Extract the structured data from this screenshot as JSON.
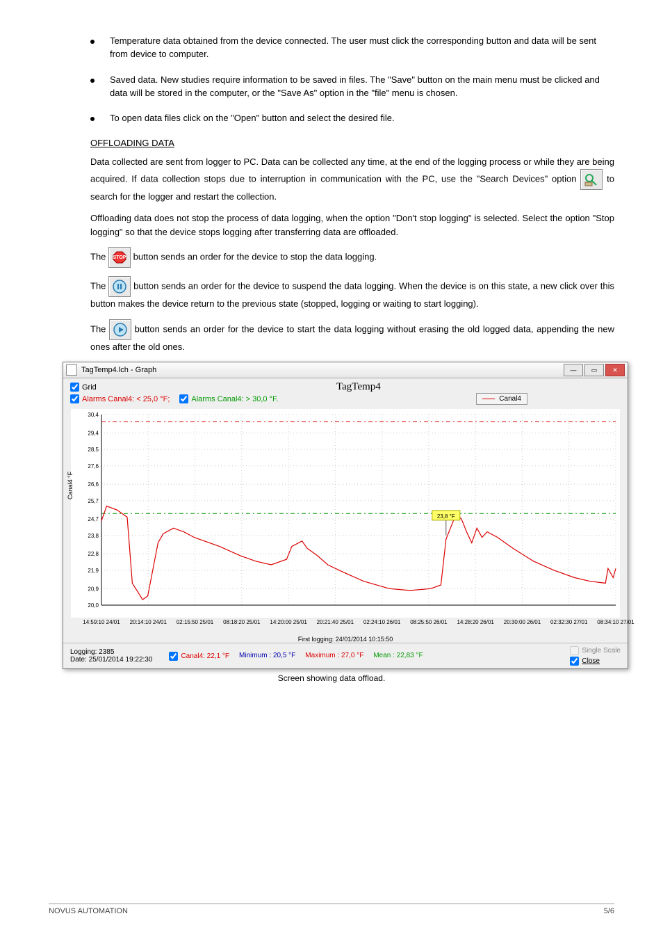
{
  "bullets": [
    "Temperature data obtained from the device connected. The user must click the corresponding button and data will be sent from device to computer.",
    "Saved data. New studies require information to be saved in files. The \"Save\" button on the main menu must be clicked and data will be stored in the computer, or the \"Save As\" option in the \"file\" menu is chosen.",
    "To open data files click on the \"Open\" button and select the desired file."
  ],
  "section_title": "OFFLOADING DATA",
  "p1_a": "Data collected are sent from logger to PC. Data can be collected any time, at the end of the logging process or while they are being acquired. If data collection stops due to interruption in communication with the PC, use the \"Search Devices\" option ",
  "p1_b": " to search for the logger and restart the collection.",
  "p2": "Offloading data does not stop the process of data logging, when the option \"Don't stop logging\" is selected. Select the option \"Stop logging\" so that the device stops logging after transferring data are offloaded.",
  "p3_a": "The ",
  "p3_b": " button sends an order for the device to stop the data logging.",
  "p4_a": "The ",
  "p4_b": " button sends an order for the device to suspend the data logging. When the device is on this state, a new click over this button makes the device return to the previous state (stopped, logging or waiting to start logging).",
  "p5_a": "The ",
  "p5_b": " button sends an order for the device to start the data logging without erasing the old logged data, appending the new ones after the old ones.",
  "window_title": "TagTemp4.lch - Graph",
  "grid_lbl": "Grid",
  "alarm_lo": "Alarms Canal4: < 25,0 °F;",
  "alarm_hi": "Alarms Canal4: > 30,0 °F.",
  "chart_title": "TagTemp4",
  "legend": "Canal4",
  "ylabel": "Canal4 °F",
  "marker_val": "23,8 °F",
  "firstlog": "First logging: 24/01/2014 10:15:50",
  "status_left1": "Logging: 2385",
  "status_left2": "Date: 25/01/2014 19:22:30",
  "stat_canal": "Canal4: 22,1 °F",
  "stat_min": "Minimum : 20,5 °F",
  "stat_max": "Maximum : 27,0 °F",
  "stat_mean": "Mean : 22,83 °F",
  "single_scale": "Single Scale",
  "close_lbl": "Close",
  "under_graph": "Screen showing data offload.",
  "footer_left": "NOVUS AUTOMATION",
  "footer_right": "5/6",
  "chart_data": {
    "type": "line",
    "title": "TagTemp4",
    "ylabel": "Canal4 °F",
    "ylim": [
      20.0,
      30.4
    ],
    "yticks": [
      30.4,
      29.4,
      28.5,
      27.6,
      26.6,
      25.7,
      24.7,
      23.8,
      22.8,
      21.9,
      20.9,
      20.0
    ],
    "xticks": [
      "14:59:10 24/01",
      "20:14:10 24/01",
      "02:15:50 25/01",
      "08:18:20 25/01",
      "14:20:00 25/01",
      "20:21:40 25/01",
      "02:24:10 26/01",
      "08:25:50 26/01",
      "14:28:20 26/01",
      "20:30:00 26/01",
      "02:32:30 27/01",
      "08:34:10 27/01"
    ],
    "alarm_low": 25.0,
    "alarm_high": 30.0,
    "series": [
      {
        "name": "Canal4",
        "color": "#d00",
        "x": [
          0,
          0.01,
          0.03,
          0.05,
          0.06,
          0.08,
          0.09,
          0.11,
          0.12,
          0.14,
          0.16,
          0.18,
          0.2,
          0.23,
          0.27,
          0.3,
          0.33,
          0.36,
          0.37,
          0.39,
          0.4,
          0.42,
          0.44,
          0.47,
          0.51,
          0.56,
          0.6,
          0.64,
          0.66,
          0.67,
          0.69,
          0.7,
          0.71,
          0.72,
          0.73,
          0.74,
          0.75,
          0.77,
          0.8,
          0.84,
          0.88,
          0.92,
          0.95,
          0.98,
          0.985,
          0.995,
          1.0
        ],
        "y": [
          24.6,
          25.4,
          25.2,
          24.8,
          21.2,
          20.3,
          20.5,
          23.4,
          23.9,
          24.2,
          24.0,
          23.7,
          23.5,
          23.2,
          22.7,
          22.4,
          22.2,
          22.5,
          23.2,
          23.5,
          23.1,
          22.7,
          22.2,
          21.8,
          21.3,
          20.9,
          20.8,
          20.9,
          21.1,
          23.6,
          25.0,
          24.7,
          24.0,
          23.4,
          24.2,
          23.7,
          24.0,
          23.7,
          23.1,
          22.4,
          21.9,
          21.5,
          21.3,
          21.2,
          22.0,
          21.5,
          22.0
        ]
      }
    ],
    "marker": {
      "x": 0.67,
      "value": 23.8,
      "label": "23,8 °F"
    }
  }
}
